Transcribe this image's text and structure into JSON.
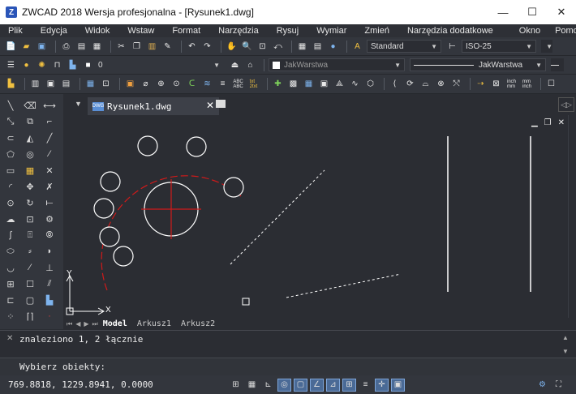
{
  "window": {
    "title": "ZWCAD 2018 Wersja profesjonalna - [Rysunek1.dwg]",
    "app_icon": "Z",
    "minimize": "—",
    "maximize": "☐",
    "close": "✕"
  },
  "menu": [
    "Plik",
    "Edycja",
    "Widok",
    "Wstaw",
    "Format",
    "Narzędzia",
    "Rysuj",
    "Wymiar",
    "Zmień",
    "Narzędzia dodatkowe",
    "Okno",
    "Pomoc"
  ],
  "toolbar1": {
    "text_style": "Standard",
    "dim_style": "ISO-25"
  },
  "toolbar2": {
    "layer": "0",
    "color": "JakWarstwa",
    "linetype": "JakWarstwa"
  },
  "document_tab": {
    "label": "Rysunek1.dwg",
    "badge": "DWG",
    "close": "✕"
  },
  "viewport_controls": {
    "minimize": "▁",
    "restore": "❐",
    "close": "✕"
  },
  "ucs": {
    "x": "X",
    "y": "Y"
  },
  "sheets": [
    "Model",
    "Arkusz1",
    "Arkusz2"
  ],
  "command": {
    "history": "znaleziono 1, 2 łącznie",
    "prompt": "Wybierz obiekty:"
  },
  "status": {
    "coordinates": "769.8818, 1229.8941, 0.0000"
  },
  "colors": {
    "background": "#2b2d33",
    "geometry": "#ffffff",
    "construction": "#d11a1a",
    "accent": "#4a6a96"
  }
}
